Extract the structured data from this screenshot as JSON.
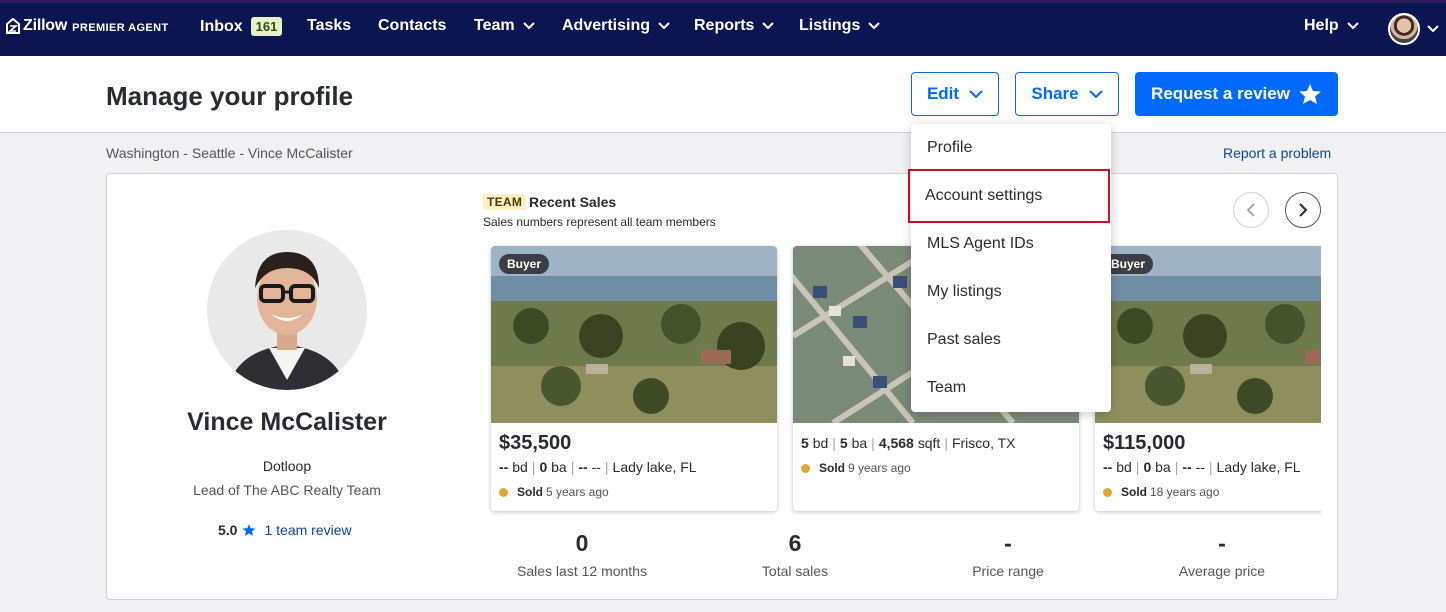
{
  "nav": {
    "brand": "Zillow",
    "brand_sub": "PREMIER AGENT",
    "inbox_label": "Inbox",
    "inbox_count": "161",
    "tasks_label": "Tasks",
    "contacts_label": "Contacts",
    "team_label": "Team",
    "advertising_label": "Advertising",
    "reports_label": "Reports",
    "listings_label": "Listings",
    "help_label": "Help"
  },
  "header": {
    "title": "Manage your profile",
    "edit_label": "Edit",
    "share_label": "Share",
    "review_label": "Request a review"
  },
  "breadcrumb": "Washington - Seattle - Vince McCalister",
  "report_link": "Report a problem",
  "agent": {
    "name": "Vince McCalister",
    "company": "Dotloop",
    "role": "Lead of The ABC Realty Team",
    "rating": "5.0",
    "reviews_link": "1 team review"
  },
  "sales": {
    "tag": "TEAM",
    "title": "Recent Sales",
    "subtitle": "Sales numbers represent all team members",
    "listings": [
      {
        "badge": "Buyer",
        "price": "$35,500",
        "beds": "--",
        "beds_unit": "bd",
        "baths": "0",
        "baths_unit": "ba",
        "sqft": "--",
        "sqft_unit": "--",
        "location": "Lady lake, FL",
        "sold_label": "Sold",
        "sold_when": "5 years ago"
      },
      {
        "badge": "",
        "price": "",
        "beds": "5",
        "beds_unit": "bd",
        "baths": "5",
        "baths_unit": "ba",
        "sqft": "4,568",
        "sqft_unit": "sqft",
        "location": "Frisco, TX",
        "sold_label": "Sold",
        "sold_when": "9 years ago"
      },
      {
        "badge": "Buyer",
        "price": "$115,000",
        "beds": "--",
        "beds_unit": "bd",
        "baths": "0",
        "baths_unit": "ba",
        "sqft": "--",
        "sqft_unit": "--",
        "location": "Lady lake, FL",
        "sold_label": "Sold",
        "sold_when": "18 years ago"
      }
    ]
  },
  "stats": [
    {
      "value": "0",
      "label": "Sales last 12 months"
    },
    {
      "value": "6",
      "label": "Total sales"
    },
    {
      "value": "-",
      "label": "Price range"
    },
    {
      "value": "-",
      "label": "Average price"
    }
  ],
  "edit_menu": {
    "items": [
      "Profile",
      "Account settings",
      "MLS Agent IDs",
      "My listings",
      "Past sales",
      "Team"
    ]
  },
  "icons": {
    "logo": "zillow-house-icon",
    "chevron": "chevron-down-icon",
    "star": "star-icon",
    "prev": "chevron-left-icon",
    "next": "chevron-right-icon"
  },
  "colors": {
    "nav_bg": "#0a1551",
    "accent": "#006aff",
    "link": "#0d4599",
    "sold_dot": "#e0a832",
    "highlight_border": "#c8102e"
  }
}
